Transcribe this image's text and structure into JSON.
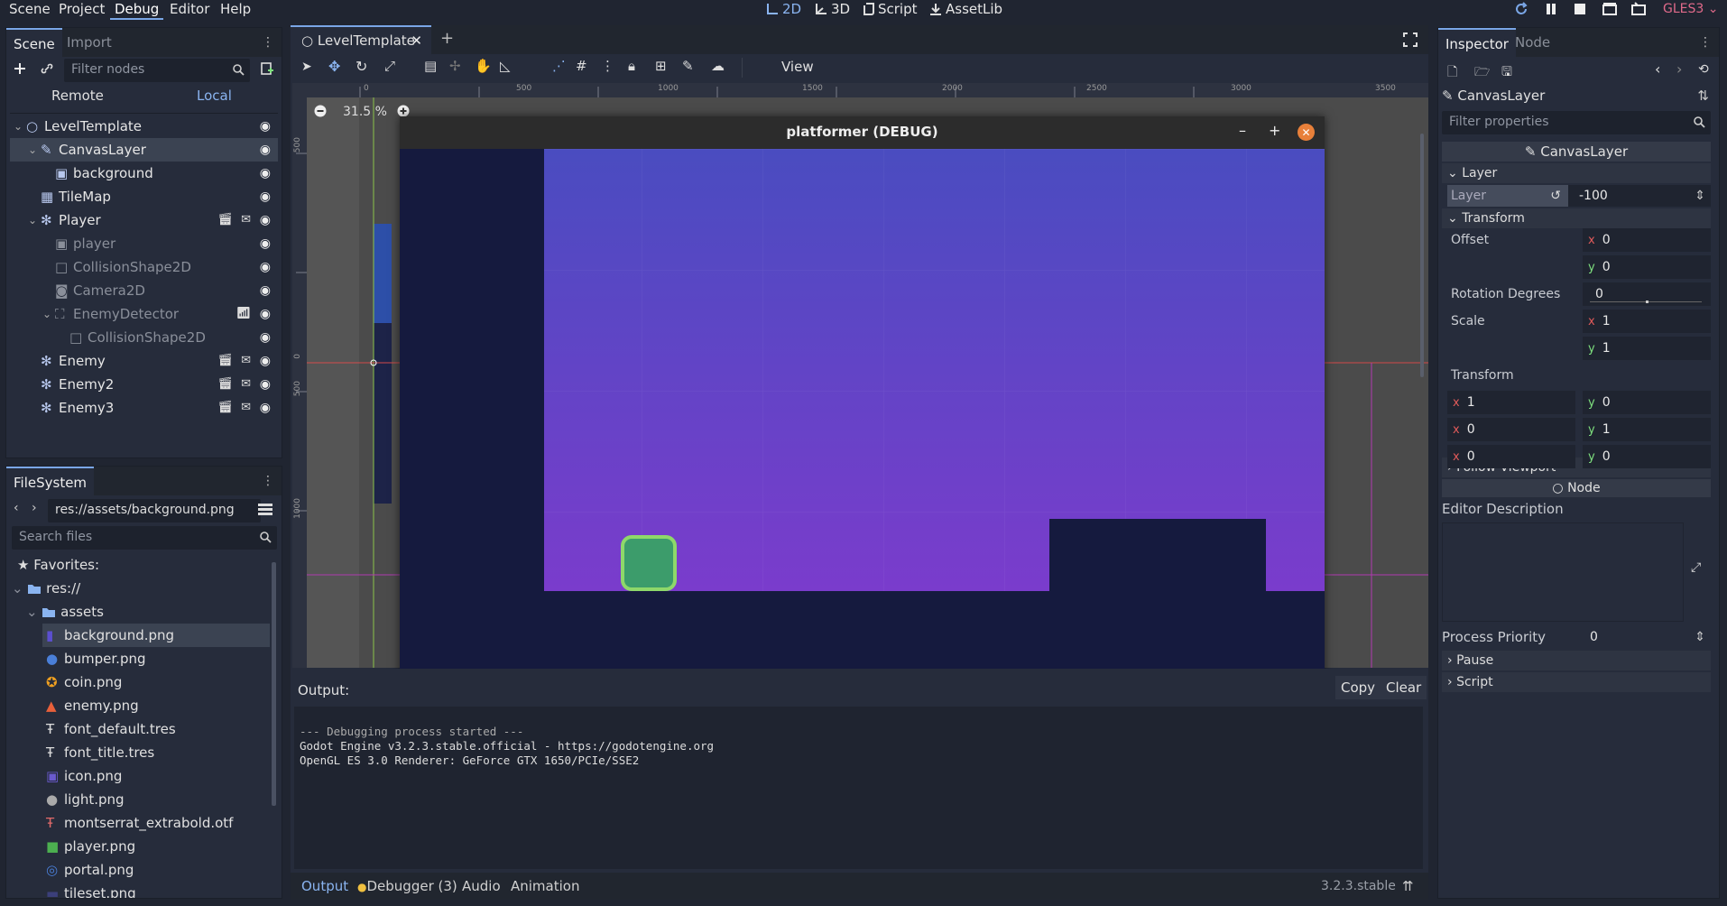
{
  "menubar": {
    "items": [
      "Scene",
      "Project",
      "Debug",
      "Editor",
      "Help"
    ],
    "active": "Debug",
    "modes": [
      "2D",
      "3D",
      "Script",
      "AssetLib"
    ],
    "renderer": "GLES3"
  },
  "scene_dock": {
    "tabs": [
      "Scene",
      "Import"
    ],
    "filter_placeholder": "Filter nodes",
    "remote_label": "Remote",
    "local_label": "Local",
    "tree": [
      {
        "label": "LevelTemplate",
        "icon": "node-circle-icon",
        "depth": 0
      },
      {
        "label": "CanvasLayer",
        "icon": "canvaslayer-icon",
        "depth": 1,
        "selected": true
      },
      {
        "label": "background",
        "icon": "sprite-icon",
        "depth": 2
      },
      {
        "label": "TileMap",
        "icon": "tilemap-icon",
        "depth": 1
      },
      {
        "label": "Player",
        "icon": "kinematic-body-icon",
        "depth": 1
      },
      {
        "label": "player",
        "icon": "sprite-icon",
        "depth": 2,
        "dim": true
      },
      {
        "label": "CollisionShape2D",
        "icon": "collision-shape-icon",
        "depth": 2,
        "dim": true
      },
      {
        "label": "Camera2D",
        "icon": "camera-icon",
        "depth": 2,
        "dim": true
      },
      {
        "label": "EnemyDetector",
        "icon": "area2d-icon",
        "depth": 2,
        "dim": true
      },
      {
        "label": "CollisionShape2D",
        "icon": "collision-shape-icon",
        "depth": 3,
        "dim": true
      },
      {
        "label": "Enemy",
        "icon": "kinematic-body-icon",
        "depth": 1
      },
      {
        "label": "Enemy2",
        "icon": "kinematic-body-icon",
        "depth": 1
      },
      {
        "label": "Enemy3",
        "icon": "kinematic-body-icon",
        "depth": 1
      }
    ]
  },
  "filesystem": {
    "tab": "FileSystem",
    "path": "res://assets/background.png",
    "search_placeholder": "Search files",
    "favorites": "Favorites:",
    "root": "res://",
    "folder": "assets",
    "files": [
      "background.png",
      "bumper.png",
      "coin.png",
      "enemy.png",
      "font_default.tres",
      "font_title.tres",
      "icon.png",
      "light.png",
      "montserrat_extrabold.otf",
      "player.png",
      "portal.png",
      "tileset.png"
    ]
  },
  "editor": {
    "scene_tab": "LevelTemplate",
    "view_menu": "View",
    "zoom": "31.5 %",
    "ruler_ticks": [
      "0",
      "500",
      "1000",
      "1500",
      "2000",
      "2500",
      "3000",
      "3500"
    ],
    "vruler_ticks": [
      "500",
      "0",
      "500",
      "1000"
    ]
  },
  "game_window": {
    "title": "platformer (DEBUG)"
  },
  "output": {
    "label": "Output:",
    "copy": "Copy",
    "clear": "Clear",
    "lines": [
      "--- Debugging process started ---",
      "Godot Engine v3.2.3.stable.official - https://godotengine.org",
      "OpenGL ES 3.0 Renderer: GeForce GTX 1650/PCIe/SSE2"
    ]
  },
  "bottom_tabs": {
    "output": "Output",
    "debugger": "Debugger (3)",
    "audio": "Audio",
    "animation": "Animation",
    "version": "3.2.3.stable"
  },
  "inspector": {
    "tabs": [
      "Inspector",
      "Node"
    ],
    "object": "CanvasLayer",
    "filter_placeholder": "Filter properties",
    "class_header": "CanvasLayer",
    "layer_section": "Layer",
    "layer_label": "Layer",
    "layer_value": "-100",
    "transform_section": "Transform",
    "offset_label": "Offset",
    "offset_x": "0",
    "offset_y": "0",
    "rotation_label": "Rotation Degrees",
    "rotation_value": "0",
    "scale_label": "Scale",
    "scale_x": "1",
    "scale_y": "1",
    "transform_label": "Transform",
    "matrix": [
      [
        "1",
        "0"
      ],
      [
        "0",
        "1"
      ],
      [
        "0",
        "0"
      ]
    ],
    "follow_viewport": "Follow Viewport",
    "node_header": "Node",
    "editor_description": "Editor Description",
    "process_priority_label": "Process Priority",
    "process_priority_value": "0",
    "pause": "Pause",
    "script": "Script"
  },
  "colors": {
    "accent": "#7aa6e6",
    "bg": "#202531",
    "panel": "#262c3b",
    "game_dark": "#151a3e",
    "player_green": "#3c9c6b"
  }
}
